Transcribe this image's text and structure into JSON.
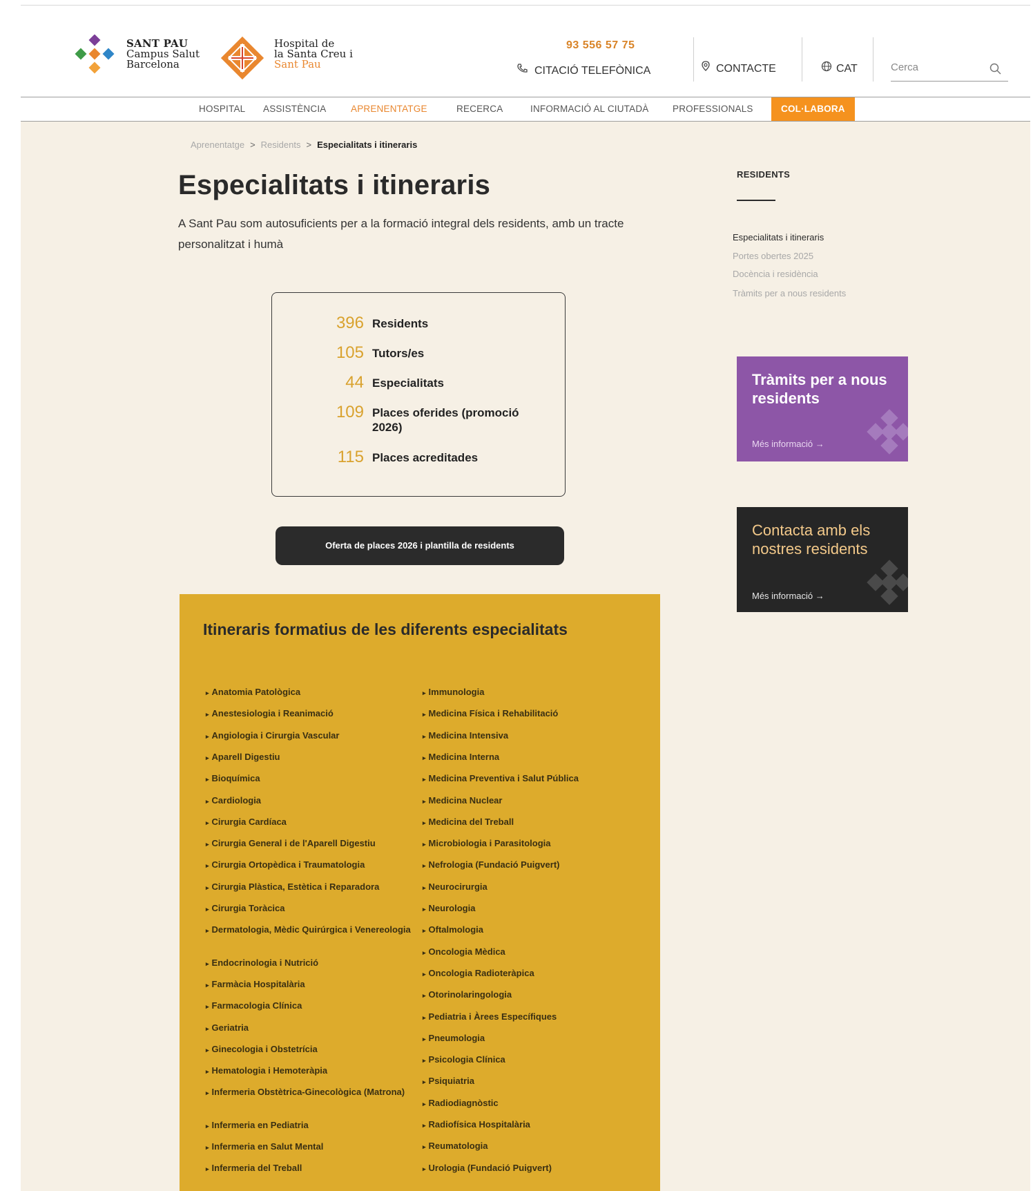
{
  "header": {
    "logo_santpau": {
      "line1": "SANT PAU",
      "line2": "Campus Salut",
      "line3": "Barcelona"
    },
    "logo_hospital": {
      "line1": "Hospital de",
      "line2": "la Santa Creu i",
      "line3": "Sant Pau"
    },
    "phone_number": "93 556 57 75",
    "phone_label": "CITACIÓ TELEFÒNICA",
    "contact_label": "CONTACTE",
    "lang_label": "CAT",
    "search_placeholder": "Cerca"
  },
  "nav": {
    "items": [
      "HOSPITAL",
      "ASSISTÈNCIA",
      "APRENENTATGE",
      "RECERCA",
      "INFORMACIÓ AL CIUTADÀ",
      "PROFESSIONALS",
      "COL·LABORA"
    ],
    "active": "APRENENTATGE",
    "cta": "COL·LABORA"
  },
  "breadcrumb": {
    "items": [
      "Aprenentatge",
      "Residents"
    ],
    "current": "Especialitats i itineraris"
  },
  "page": {
    "title": "Especialitats i itineraris",
    "intro": "A Sant Pau som autosuficients per a la formació integral dels residents, amb un tracte personalitzat i humà"
  },
  "stats": [
    {
      "value": "396",
      "label": "Residents"
    },
    {
      "value": "105",
      "label": "Tutors/es"
    },
    {
      "value": "44",
      "label": "Especialitats"
    },
    {
      "value": "109",
      "label": "Places oferides (promoció 2026)"
    },
    {
      "value": "115",
      "label": "Places acreditades"
    }
  ],
  "oferta_button": "Oferta de places 2026 i plantilla de residents",
  "itineraris": {
    "title": "Itineraris formatius de les diferents especialitats",
    "col1": [
      "Anatomia Patològica",
      "Anestesiologia i Reanimació",
      "Angiologia i Cirurgia Vascular",
      "Aparell Digestiu",
      "Bioquímica",
      "Cardiologia",
      "Cirurgia Cardíaca",
      "Cirurgia General i de l'Aparell Digestiu",
      "Cirurgia Ortopèdica i Traumatologia",
      "Cirurgia Plàstica, Estètica i Reparadora",
      "Cirurgia Toràcica",
      "Dermatologia, Mèdic Quirúrgica i Venereologia",
      "Endocrinologia i Nutrició",
      "Farmàcia Hospitalària",
      "Farmacologia Clínica",
      "Geriatria",
      "Ginecologia i Obstetrícia",
      "Hematologia i Hemoteràpia",
      "Infermeria Obstètrica-Ginecològica (Matrona)",
      "Infermeria en Pediatria",
      "Infermeria en Salut Mental",
      "Infermeria del Treball"
    ],
    "col2": [
      "Immunologia",
      "Medicina Física i Rehabilitació",
      "Medicina Intensiva",
      "Medicina Interna",
      "Medicina Preventiva i Salut Pública",
      "Medicina Nuclear",
      "Medicina del Treball",
      "Microbiologia i Parasitologia",
      "Nefrologia (Fundació Puigvert)",
      "Neurocirurgia",
      "Neurologia",
      "Oftalmologia",
      "Oncologia Mèdica",
      "Oncologia Radioteràpica",
      "Otorinolaringologia",
      "Pediatria i Àrees Específiques",
      "Pneumologia",
      "Psicologia Clínica",
      "Psiquiatria",
      "Radiodiagnòstic",
      "Radiofísica Hospitalària",
      "Reumatologia",
      "Urologia (Fundació Puigvert)"
    ]
  },
  "sidebar": {
    "heading": "RESIDENTS",
    "links": [
      "Especialitats i itineraris",
      "Portes obertes 2025",
      "Docència i residència",
      "Tràmits per a nous residents"
    ],
    "current": "Especialitats i itineraris"
  },
  "promos": [
    {
      "title": "Tràmits per a nous residents",
      "more": "Més informació  →",
      "color": "#8d56a7"
    },
    {
      "title": "Contacta amb els nostres residents",
      "more": "Més informació  →",
      "color": "#262626"
    }
  ],
  "colors": {
    "accent_orange": "#f5921e",
    "stat_gold": "#d9a22e",
    "panel_gold": "#ddab2c",
    "page_bg": "#f6f0e5"
  }
}
